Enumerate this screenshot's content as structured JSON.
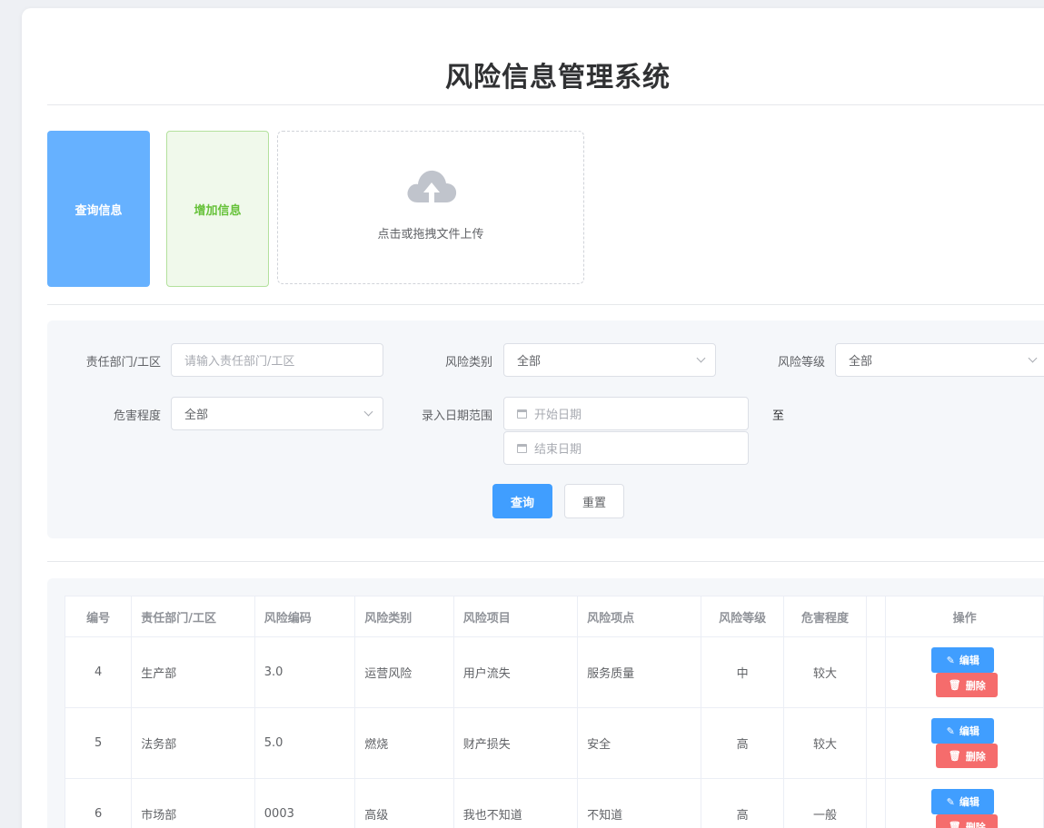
{
  "title": "风险信息管理系统",
  "actions": {
    "query_label": "查询信息",
    "add_label": "增加信息",
    "upload_text": "点击或拖拽文件上传"
  },
  "filters": {
    "dept_label": "责任部门/工区",
    "dept_placeholder": "请输入责任部门/工区",
    "category_label": "风险类别",
    "category_value": "全部",
    "level_label": "风险等级",
    "level_value": "全部",
    "harm_label": "危害程度",
    "harm_value": "全部",
    "date_label": "录入日期范围",
    "start_placeholder": "开始日期",
    "end_placeholder": "结束日期",
    "range_sep": "至",
    "search_label": "查询",
    "reset_label": "重置"
  },
  "table": {
    "headers": [
      "编号",
      "责任部门/工区",
      "风险编码",
      "风险类别",
      "风险项目",
      "风险项点",
      "风险等级",
      "危害程度",
      "操作"
    ],
    "rows": [
      [
        "4",
        "生产部",
        "3.0",
        "运营风险",
        "用户流失",
        "服务质量",
        "中",
        "较大"
      ],
      [
        "5",
        "法务部",
        "5.0",
        "燃烧",
        "财产损失",
        "安全",
        "高",
        "较大"
      ],
      [
        "6",
        "市场部",
        "0003",
        "高级",
        "我也不知道",
        "不知道",
        "高",
        "一般"
      ]
    ],
    "edit_label": "编辑",
    "delete_label": "删除"
  },
  "icons": {
    "upload": "cloud-upload-icon",
    "edit": "pencil-icon",
    "delete": "trash-icon",
    "calendar": "calendar-icon"
  },
  "colors": {
    "primary": "#409eff",
    "success": "#67c23a",
    "danger": "#f56c6c"
  }
}
